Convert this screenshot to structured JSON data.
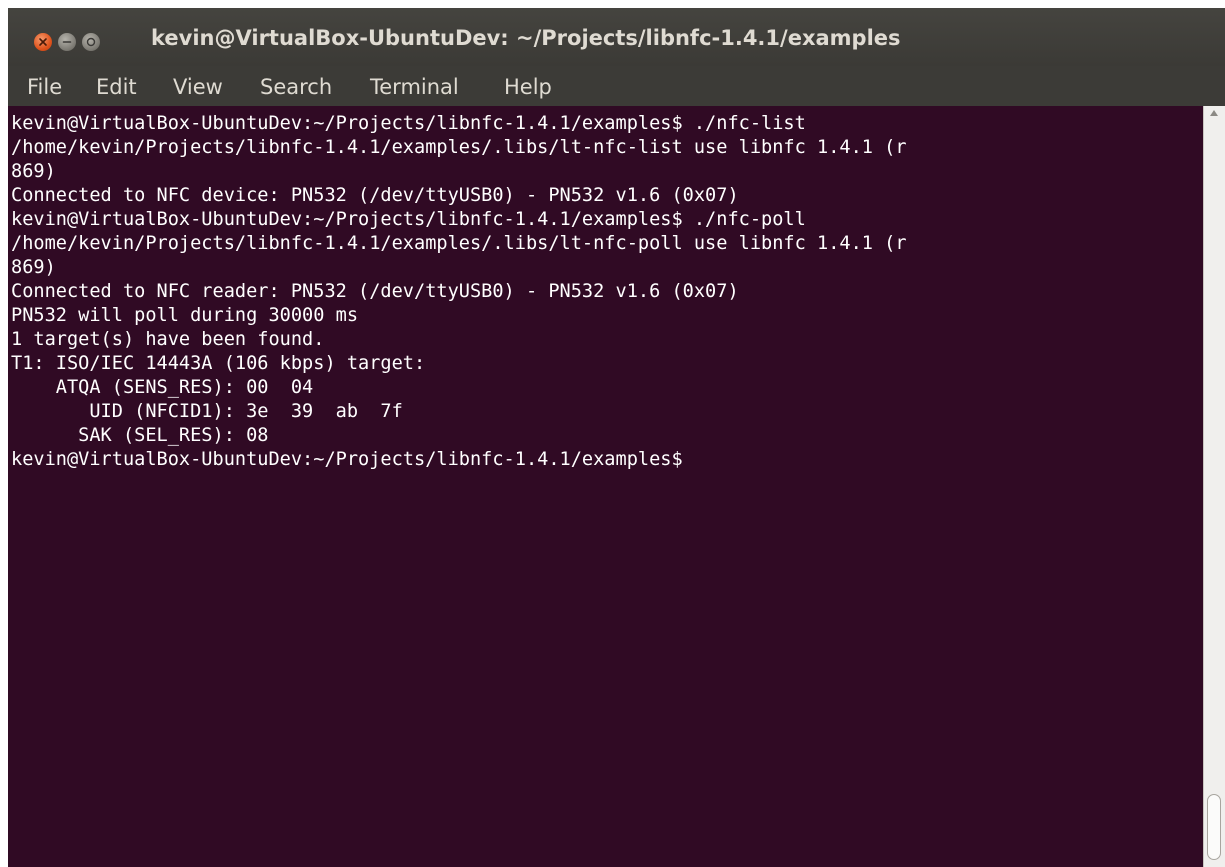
{
  "window": {
    "title": "kevin@VirtualBox-UbuntuDev: ~/Projects/libnfc-1.4.1/examples"
  },
  "menu": {
    "file": "File",
    "edit": "Edit",
    "view": "View",
    "search": "Search",
    "terminal": "Terminal",
    "help": "Help"
  },
  "terminal": {
    "lines": [
      "kevin@VirtualBox-UbuntuDev:~/Projects/libnfc-1.4.1/examples$ ./nfc-list",
      "/home/kevin/Projects/libnfc-1.4.1/examples/.libs/lt-nfc-list use libnfc 1.4.1 (r",
      "869)",
      "Connected to NFC device: PN532 (/dev/ttyUSB0) - PN532 v1.6 (0x07)",
      "kevin@VirtualBox-UbuntuDev:~/Projects/libnfc-1.4.1/examples$ ./nfc-poll",
      "/home/kevin/Projects/libnfc-1.4.1/examples/.libs/lt-nfc-poll use libnfc 1.4.1 (r",
      "869)",
      "Connected to NFC reader: PN532 (/dev/ttyUSB0) - PN532 v1.6 (0x07)",
      "PN532 will poll during 30000 ms",
      "1 target(s) have been found.",
      "T1: ISO/IEC 14443A (106 kbps) target:",
      "    ATQA (SENS_RES): 00  04",
      "       UID (NFCID1): 3e  39  ab  7f",
      "      SAK (SEL_RES): 08",
      "kevin@VirtualBox-UbuntuDev:~/Projects/libnfc-1.4.1/examples$"
    ]
  },
  "icons": {
    "close": "close-icon",
    "minimize": "minimize-icon",
    "maximize": "maximize-icon"
  },
  "colors": {
    "terminal_bg": "#300a24",
    "terminal_fg": "#ffffff",
    "titlebar_bg": "#3c3b37",
    "close_button": "#e0531c"
  }
}
